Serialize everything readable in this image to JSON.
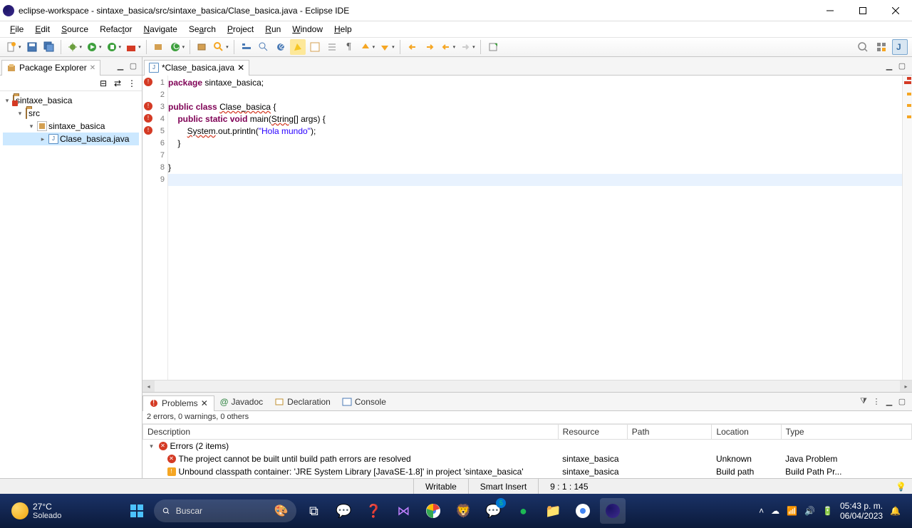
{
  "title": "eclipse-workspace - sintaxe_basica/src/sintaxe_basica/Clase_basica.java - Eclipse IDE",
  "menu": [
    "File",
    "Edit",
    "Source",
    "Refactor",
    "Navigate",
    "Search",
    "Project",
    "Run",
    "Window",
    "Help"
  ],
  "packageExplorer": {
    "title": "Package Explorer",
    "project": "sintaxe_basica",
    "src": "src",
    "pkg": "sintaxe_basica",
    "file": "Clase_basica.java"
  },
  "editor": {
    "tab": "*Clase_basica.java",
    "lines": {
      "l1a": "package",
      "l1b": " sintaxe_basica;",
      "l3a": "public",
      "l3b": " ",
      "l3c": "class",
      "l3d": " ",
      "l3e": "Clase_basica",
      "l3f": " {",
      "l4a": "    ",
      "l4b": "public",
      "l4c": " ",
      "l4d": "static",
      "l4e": " ",
      "l4f": "void",
      "l4g": " main(",
      "l4h": "String",
      "l4i": "[] args) {",
      "l5a": "        ",
      "l5b": "System",
      "l5c": ".out.println(",
      "l5d": "\"Hola mundo\"",
      "l5e": ");",
      "l6": "    }",
      "l8": "}"
    },
    "nums": [
      "1",
      "2",
      "3",
      "4",
      "5",
      "6",
      "7",
      "8",
      "9"
    ]
  },
  "bottom": {
    "tabs": [
      "Problems",
      "Javadoc",
      "Declaration",
      "Console"
    ],
    "summary": "2 errors, 0 warnings, 0 others",
    "cols": [
      "Description",
      "Resource",
      "Path",
      "Location",
      "Type"
    ],
    "group": "Errors (2 items)",
    "rows": [
      {
        "desc": "The project cannot be built until build path errors are resolved",
        "res": "sintaxe_basica",
        "path": "",
        "loc": "Unknown",
        "type": "Java Problem"
      },
      {
        "desc": "Unbound classpath container: 'JRE System Library [JavaSE-1.8]' in project 'sintaxe_basica'",
        "res": "sintaxe_basica",
        "path": "",
        "loc": "Build path",
        "type": "Build Path Pr..."
      }
    ]
  },
  "status": {
    "writable": "Writable",
    "insert": "Smart Insert",
    "pos": "9 : 1 : 145"
  },
  "taskbar": {
    "temp": "27°C",
    "cond": "Soleado",
    "searchPlaceholder": "Buscar",
    "time": "05:43 p. m.",
    "date": "06/04/2023"
  }
}
